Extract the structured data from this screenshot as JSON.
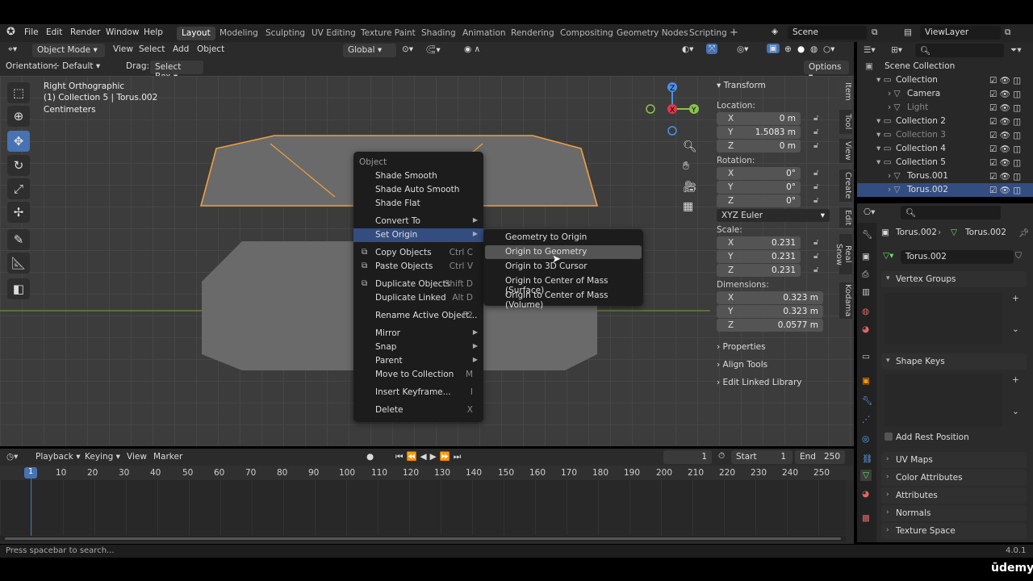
{
  "menubar": {
    "items": [
      "File",
      "Edit",
      "Render",
      "Window",
      "Help"
    ],
    "workspaces": [
      "Layout",
      "Modeling",
      "Sculpting",
      "UV Editing",
      "Texture Paint",
      "Shading",
      "Animation",
      "Rendering",
      "Compositing",
      "Geometry Nodes",
      "Scripting"
    ],
    "active_workspace": "Layout",
    "add_tab": "+",
    "scene": "Scene",
    "view_layer": "ViewLayer"
  },
  "viewport_header": {
    "mode": "Object Mode",
    "menus": [
      "View",
      "Select",
      "Add",
      "Object"
    ],
    "transform_orientation": "Global"
  },
  "tool_header": {
    "orientation_label": "Orientation:",
    "orientation_value": "Default",
    "drag_label": "Drag:",
    "drag_value": "Select Box",
    "options": "Options"
  },
  "viewport": {
    "view_name": "Right Orthographic",
    "collection_line": "(1) Collection 5 | Torus.002",
    "units": "Centimeters",
    "gizmo": {
      "z": "Z",
      "y": "Y",
      "x": "X"
    },
    "accent": "#4772b3",
    "selection_color": "#f0a040"
  },
  "context_menu": {
    "title": "Object",
    "items": [
      {
        "label": "Shade Smooth",
        "key": "",
        "arrow": false,
        "icon": ""
      },
      {
        "label": "Shade Auto Smooth",
        "key": "",
        "arrow": false,
        "icon": ""
      },
      {
        "label": "Shade Flat",
        "key": "",
        "arrow": false,
        "icon": ""
      },
      {
        "label": "Convert To",
        "key": "",
        "arrow": true,
        "icon": ""
      },
      {
        "label": "Set Origin",
        "key": "",
        "arrow": true,
        "icon": ""
      },
      {
        "label": "Copy Objects",
        "key": "Ctrl C",
        "arrow": false,
        "icon": "copy-icon"
      },
      {
        "label": "Paste Objects",
        "key": "Ctrl V",
        "arrow": false,
        "icon": "paste-icon"
      },
      {
        "label": "Duplicate Objects",
        "key": "Shift D",
        "arrow": false,
        "icon": "duplicate-icon"
      },
      {
        "label": "Duplicate Linked",
        "key": "Alt D",
        "arrow": false,
        "icon": ""
      },
      {
        "label": "Rename Active Object...",
        "key": "F2",
        "arrow": false,
        "icon": ""
      },
      {
        "label": "Mirror",
        "key": "",
        "arrow": true,
        "icon": ""
      },
      {
        "label": "Snap",
        "key": "",
        "arrow": true,
        "icon": ""
      },
      {
        "label": "Parent",
        "key": "",
        "arrow": true,
        "icon": ""
      },
      {
        "label": "Move to Collection",
        "key": "M",
        "arrow": false,
        "icon": ""
      },
      {
        "label": "Insert Keyframe...",
        "key": "I",
        "arrow": false,
        "icon": ""
      },
      {
        "label": "Delete",
        "key": "X",
        "arrow": false,
        "icon": ""
      }
    ]
  },
  "set_origin_submenu": [
    "Geometry to Origin",
    "Origin to Geometry",
    "Origin to 3D Cursor",
    "Origin to Center of Mass (Surface)",
    "Origin to Center of Mass (Volume)"
  ],
  "npanel": {
    "transform_title": "Transform",
    "location_label": "Location:",
    "location": [
      {
        "axis": "X",
        "value": "0 m"
      },
      {
        "axis": "Y",
        "value": "1.5083 m"
      },
      {
        "axis": "Z",
        "value": "0 m"
      }
    ],
    "rotation_label": "Rotation:",
    "rotation": [
      {
        "axis": "X",
        "value": "0°"
      },
      {
        "axis": "Y",
        "value": "0°"
      },
      {
        "axis": "Z",
        "value": "0°"
      }
    ],
    "rotation_mode": "XYZ Euler",
    "scale_label": "Scale:",
    "scale": [
      {
        "axis": "X",
        "value": "0.231"
      },
      {
        "axis": "Y",
        "value": "0.231"
      },
      {
        "axis": "Z",
        "value": "0.231"
      }
    ],
    "dimensions_label": "Dimensions:",
    "dimensions": [
      {
        "axis": "X",
        "value": "0.323 m"
      },
      {
        "axis": "Y",
        "value": "0.323 m"
      },
      {
        "axis": "Z",
        "value": "0.0577 m"
      }
    ],
    "sections": [
      "Properties",
      "Align Tools",
      "Edit Linked Library"
    ],
    "tabs": [
      "Item",
      "Tool",
      "View",
      "Create",
      "Edit",
      "Real Snow",
      "Kodama"
    ]
  },
  "outliner": {
    "rows": [
      {
        "label": "Scene Collection",
        "indent": 0,
        "selected": false
      },
      {
        "label": "Collection",
        "indent": 1,
        "selected": false
      },
      {
        "label": "Camera",
        "indent": 2,
        "selected": false
      },
      {
        "label": "Light",
        "indent": 2,
        "selected": false
      },
      {
        "label": "Collection 2",
        "indent": 1,
        "selected": false
      },
      {
        "label": "Collection 3",
        "indent": 1,
        "selected": false
      },
      {
        "label": "Collection 4",
        "indent": 1,
        "selected": false
      },
      {
        "label": "Collection 5",
        "indent": 1,
        "selected": false
      },
      {
        "label": "Torus.001",
        "indent": 2,
        "selected": false
      },
      {
        "label": "Torus.002",
        "indent": 2,
        "selected": true
      }
    ]
  },
  "properties": {
    "breadcrumb_object": "Torus.002",
    "breadcrumb_mesh": "Torus.002",
    "mesh_name": "Torus.002",
    "vertex_groups": "Vertex Groups",
    "shape_keys": "Shape Keys",
    "add_rest_position": "Add Rest Position",
    "sections": [
      "UV Maps",
      "Color Attributes",
      "Attributes",
      "Normals",
      "Texture Space"
    ]
  },
  "timeline": {
    "menus": [
      "Playback",
      "Keying",
      "View",
      "Marker"
    ],
    "current_frame": "1",
    "start_label": "Start",
    "start": "1",
    "end_label": "End",
    "end": "250",
    "ticks": [
      "1",
      "10",
      "20",
      "30",
      "40",
      "50",
      "60",
      "70",
      "80",
      "90",
      "100",
      "110",
      "120",
      "130",
      "140",
      "150",
      "160",
      "170",
      "180",
      "190",
      "200",
      "210",
      "220",
      "230",
      "240",
      "250"
    ]
  },
  "status": {
    "hint": "Press spacebar to search...",
    "version": "4.0.1"
  },
  "watermark": "ūdemy"
}
